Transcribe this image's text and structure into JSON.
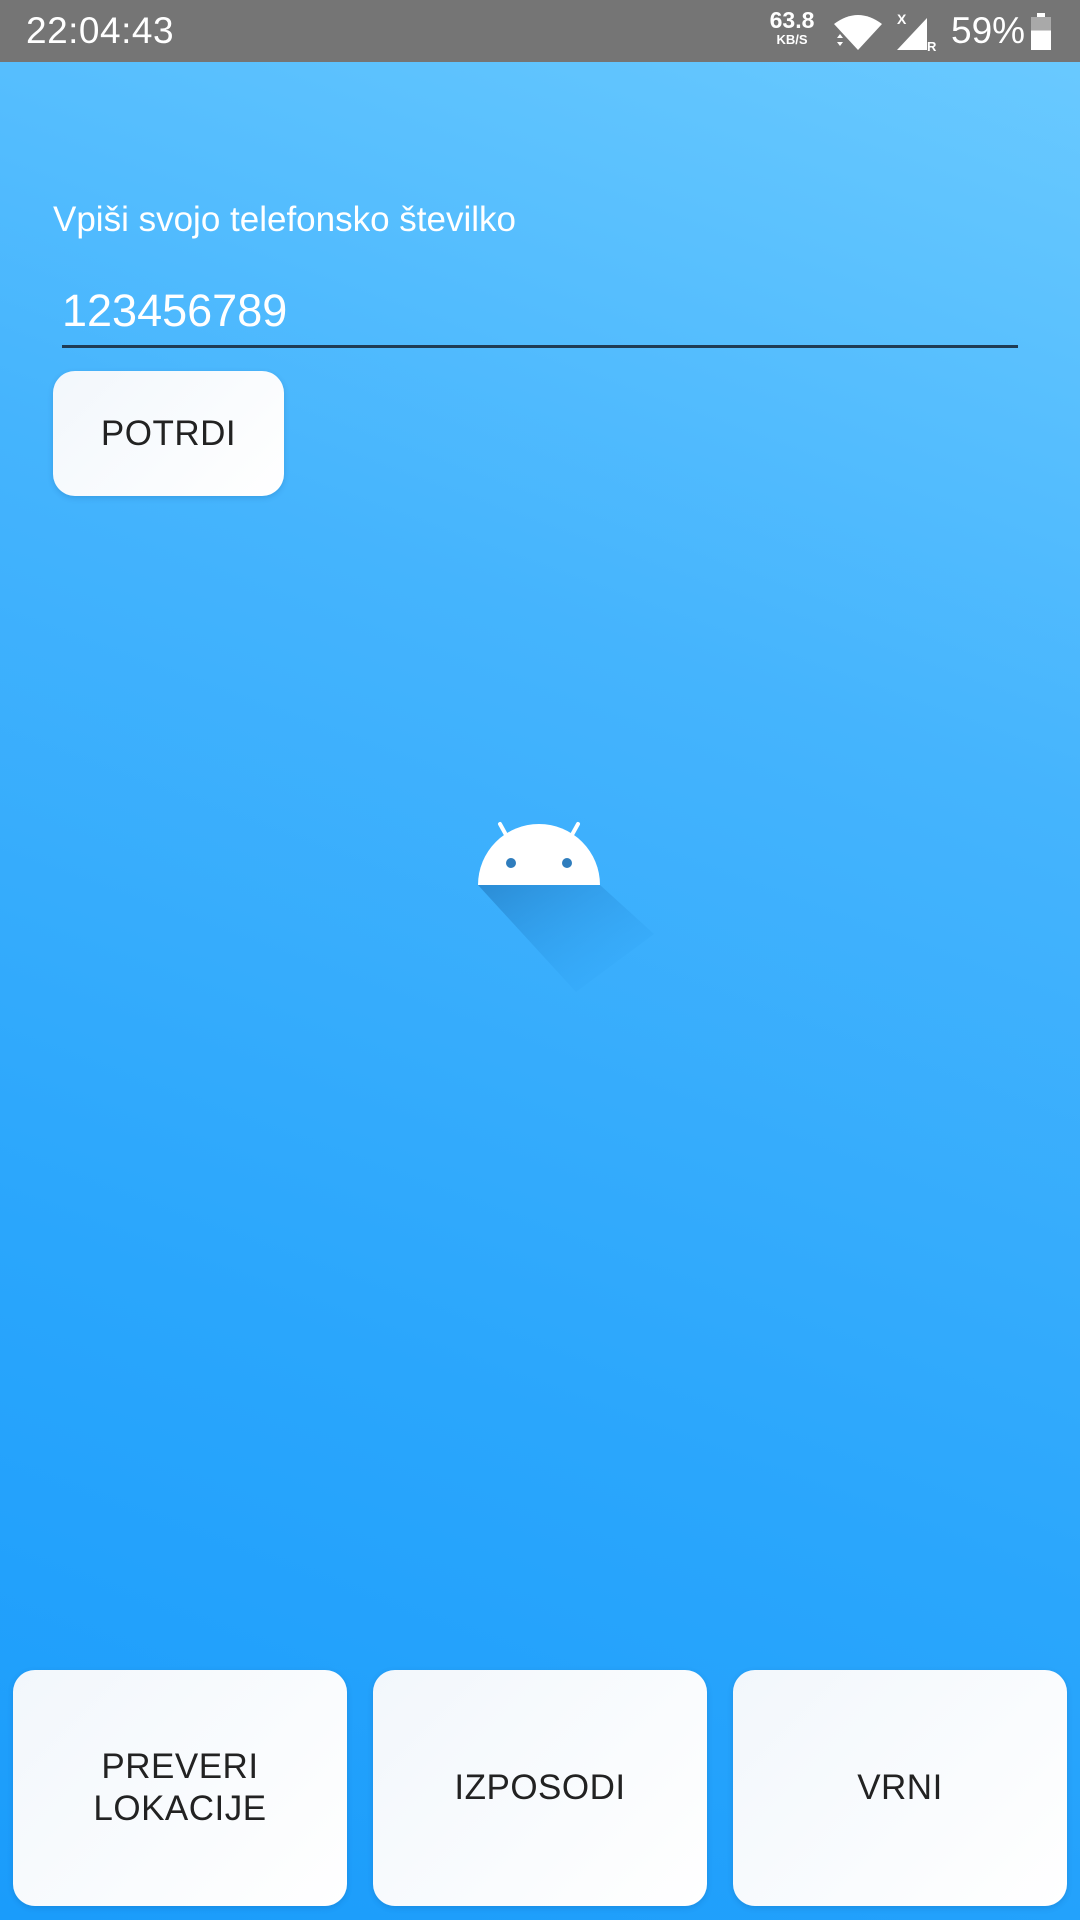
{
  "status_bar": {
    "time": "22:04:43",
    "net_speed_value": "63.8",
    "net_speed_unit": "KB/S",
    "signal_roaming_mark": "R",
    "signal_no_data_mark": "X",
    "battery_percent": "59%",
    "battery_level": 0.59,
    "icons": [
      "wifi-icon",
      "cell-signal-icon",
      "battery-icon"
    ]
  },
  "form": {
    "label": "Vpiši svojo telefonsko številko",
    "phone_value": "123456789",
    "confirm_label": "POTRDI"
  },
  "center_icon": "android-logo",
  "bottom_buttons": {
    "check_locations_label": "PREVERI\nLOKACIJE",
    "borrow_label": "IZPOSODI",
    "return_label": "VRNI"
  },
  "colors": {
    "status_bar": "#757575",
    "background_top": "#6ccbff",
    "background_bottom": "#1a9cfb",
    "input_underline": "#1f3c55",
    "button_bg": "#ffffff",
    "button_text": "#222222"
  }
}
